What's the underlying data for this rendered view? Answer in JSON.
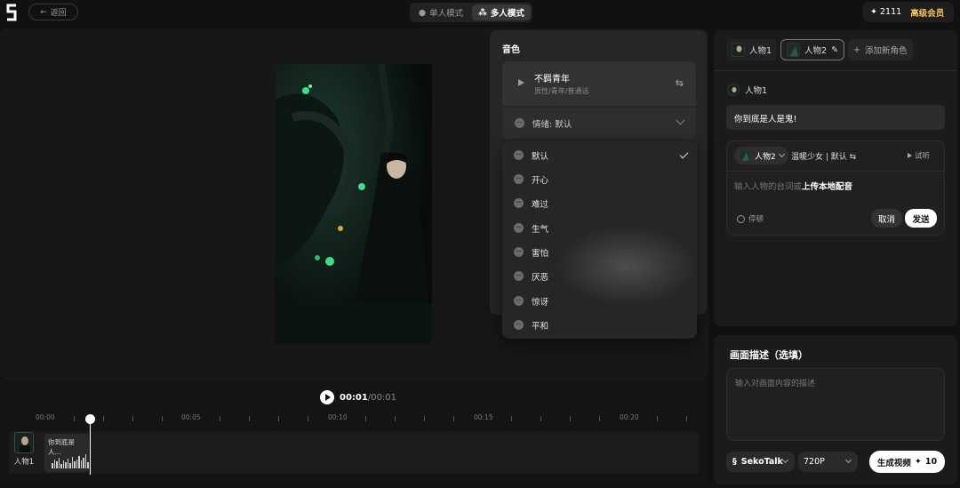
{
  "topbar": {
    "back_label": "返回",
    "modes": [
      {
        "label": "单人模式",
        "active": false
      },
      {
        "label": "多人模式",
        "active": true
      }
    ],
    "credits": "2111",
    "vip_label": "高级会员"
  },
  "player": {
    "time_current": "00:01",
    "time_total": "/00:01"
  },
  "timeline": {
    "ticks": [
      "00:00",
      "00:05",
      "00:10",
      "00:15",
      "00:20"
    ],
    "track_character": "人物1",
    "clip_text": "你到底是人..."
  },
  "voice_panel": {
    "title": "音色",
    "voice_name": "不羁青年",
    "voice_desc": "男性/青年/普通话",
    "emotion_label": "情绪: 默认",
    "emotions": [
      {
        "label": "默认",
        "selected": true
      },
      {
        "label": "开心",
        "selected": false
      },
      {
        "label": "难过",
        "selected": false
      },
      {
        "label": "生气",
        "selected": false
      },
      {
        "label": "害怕",
        "selected": false
      },
      {
        "label": "厌恶",
        "selected": false
      },
      {
        "label": "惊讶",
        "selected": false
      },
      {
        "label": "平和",
        "selected": false
      }
    ]
  },
  "characters": {
    "tabs": [
      {
        "label": "人物1",
        "active": false
      },
      {
        "label": "人物2",
        "active": true
      }
    ],
    "add_label": "添加新角色"
  },
  "dialogue": {
    "speaker": "人物1",
    "line": "你到底是人是鬼!",
    "editor_character": "人物2",
    "editor_voice": "温暖少女 | 默认",
    "try_label": "试听",
    "input_placeholder": "输入人物的台词或",
    "upload_label": "上传本地配音",
    "pause_label": "停顿",
    "cancel_label": "取消",
    "send_label": "发送"
  },
  "scene": {
    "title": "画面描述（选填）",
    "placeholder": "输入对画面内容的描述",
    "model": "SekoTalk",
    "resolution": "720P",
    "generate_label": "生成视频",
    "generate_cost": "10"
  },
  "colors": {
    "accent_vip": "#f4c35b",
    "background": "#111111",
    "panel": "#1b1b1b"
  }
}
